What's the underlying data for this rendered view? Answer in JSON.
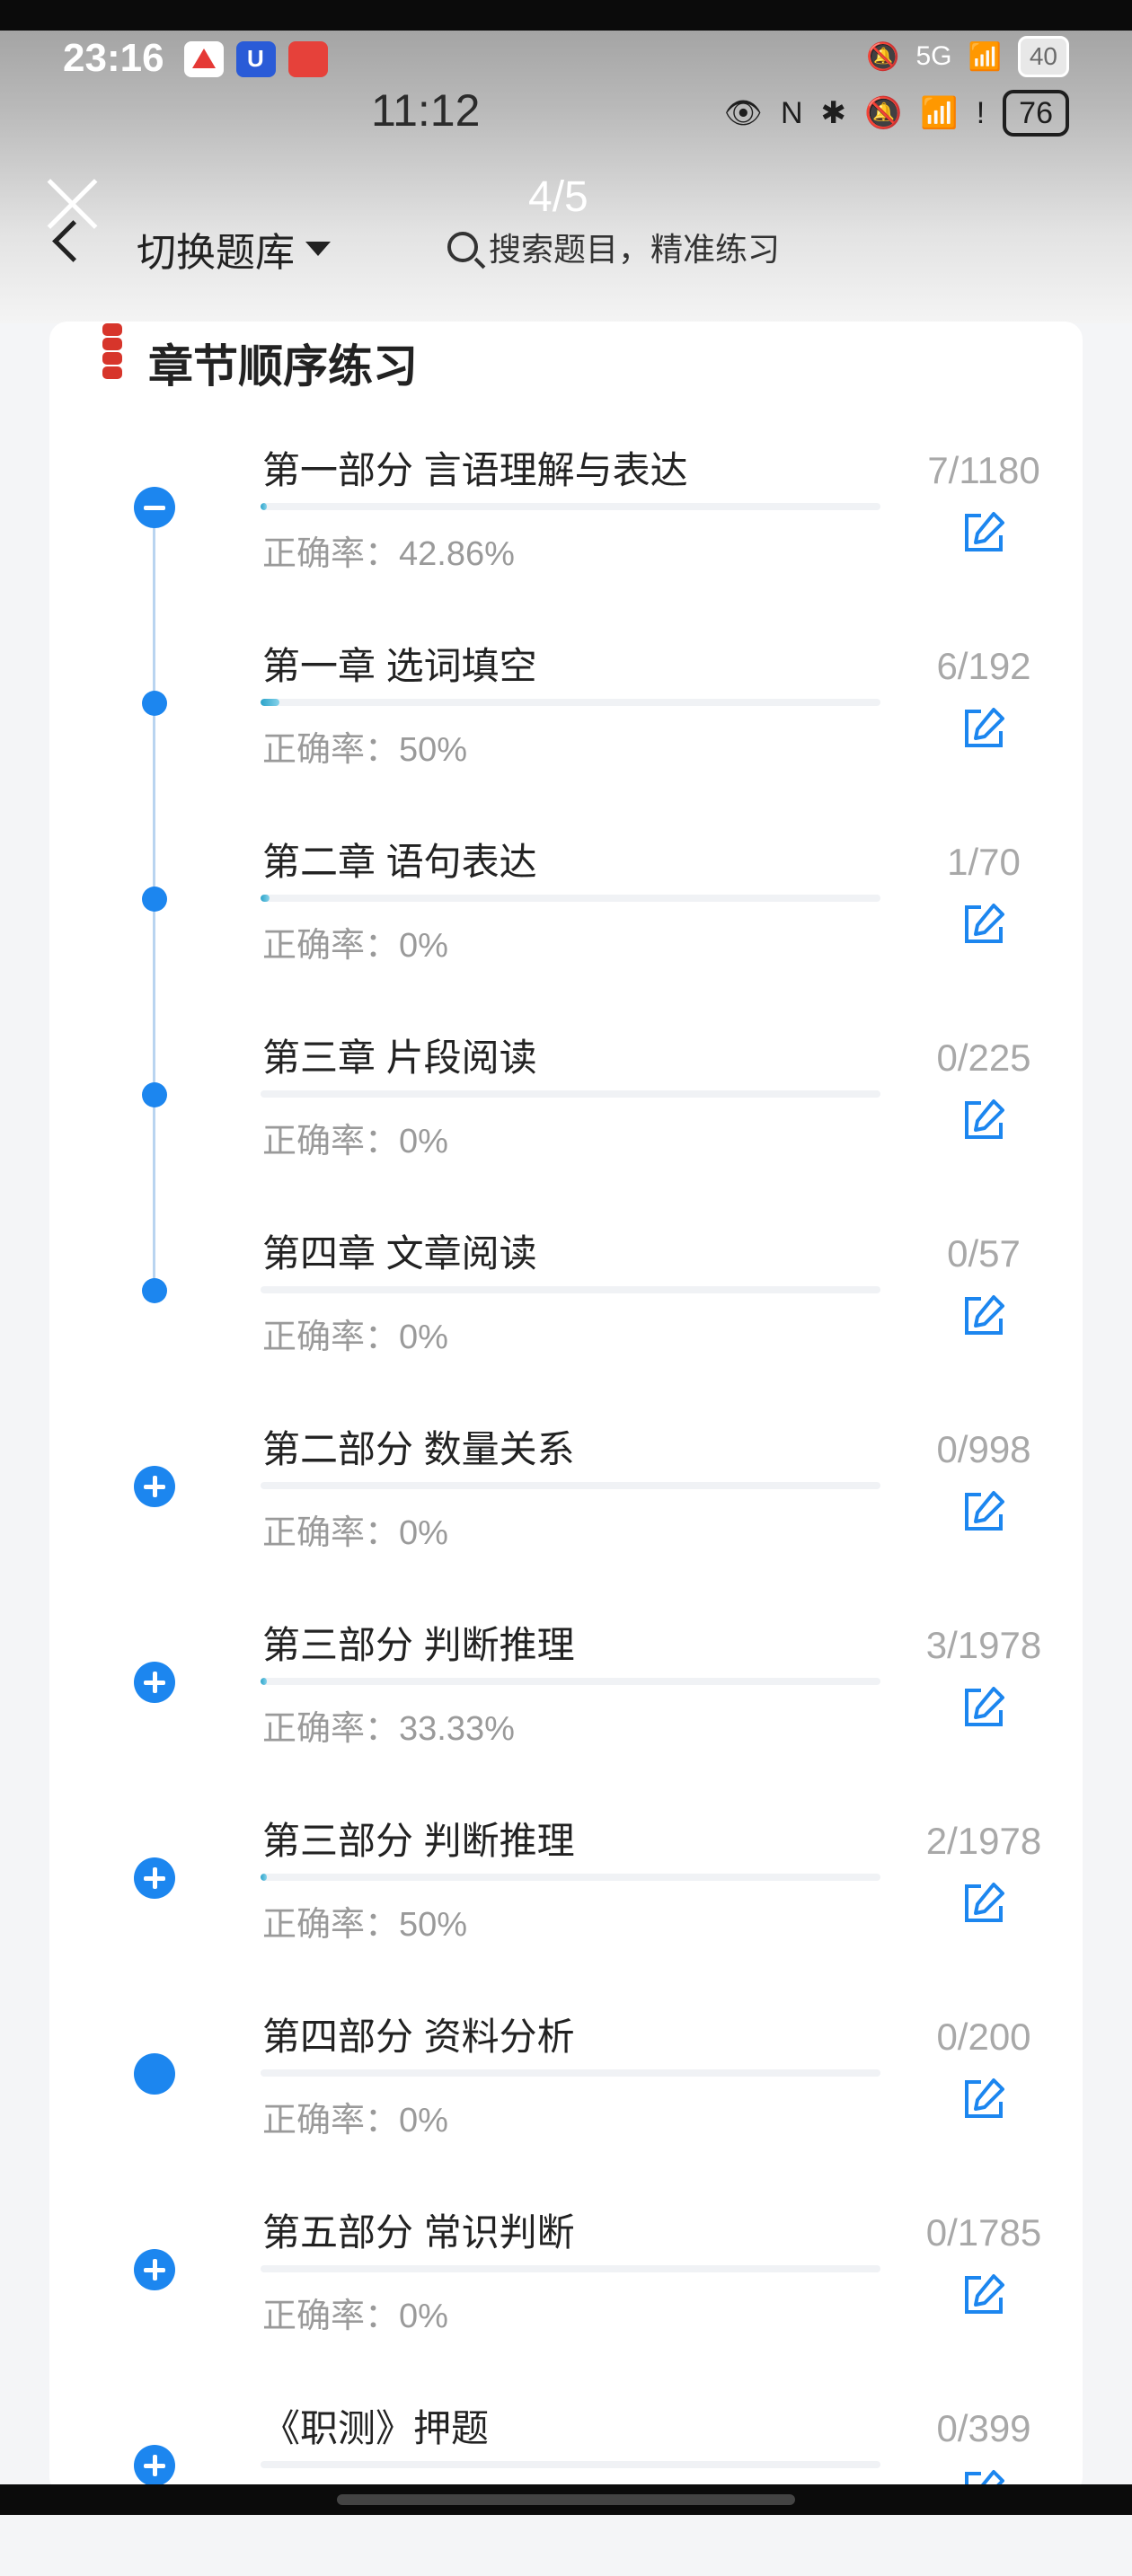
{
  "status_bar": {
    "time_top": "23:16",
    "time_main": "11:12",
    "battery_top": "40",
    "battery_main": "76",
    "network": "5G"
  },
  "header": {
    "pager": "4/5",
    "switch_bank_label": "切换题库",
    "search_placeholder": "搜索题目，精准练习"
  },
  "section": {
    "title": "章节顺序练习"
  },
  "items": [
    {
      "title": "第一部分 言语理解与表达",
      "accuracy": "正确率：42.86%",
      "count": "7/1180",
      "progress": 0.006,
      "node": "minus"
    },
    {
      "title": "第一章 选词填空",
      "accuracy": "正确率：50%",
      "count": "6/192",
      "progress": 0.031,
      "node": "dot"
    },
    {
      "title": "第二章 语句表达",
      "accuracy": "正确率：0%",
      "count": "1/70",
      "progress": 0.014,
      "node": "dot"
    },
    {
      "title": "第三章 片段阅读",
      "accuracy": "正确率：0%",
      "count": "0/225",
      "progress": 0,
      "node": "dot"
    },
    {
      "title": "第四章 文章阅读",
      "accuracy": "正确率：0%",
      "count": "0/57",
      "progress": 0,
      "node": "dot"
    },
    {
      "title": "第二部分 数量关系",
      "accuracy": "正确率：0%",
      "count": "0/998",
      "progress": 0,
      "node": "plus"
    },
    {
      "title": "第三部分 判断推理",
      "accuracy": "正确率：33.33%",
      "count": "3/1978",
      "progress": 0.002,
      "node": "plus"
    },
    {
      "title": "第三部分 判断推理",
      "accuracy": "正确率：50%",
      "count": "2/1978",
      "progress": 0.001,
      "node": "plus"
    },
    {
      "title": "第四部分 资料分析",
      "accuracy": "正确率：0%",
      "count": "0/200",
      "progress": 0,
      "node": "full"
    },
    {
      "title": "第五部分 常识判断",
      "accuracy": "正确率：0%",
      "count": "0/1785",
      "progress": 0,
      "node": "plus"
    },
    {
      "title": "《职测》押题",
      "accuracy": "",
      "count": "0/399",
      "progress": 0,
      "node": "plus"
    }
  ],
  "colors": {
    "accent": "#1c86ef",
    "progress": "#2aa3c9",
    "muted": "#9a9a9a"
  }
}
